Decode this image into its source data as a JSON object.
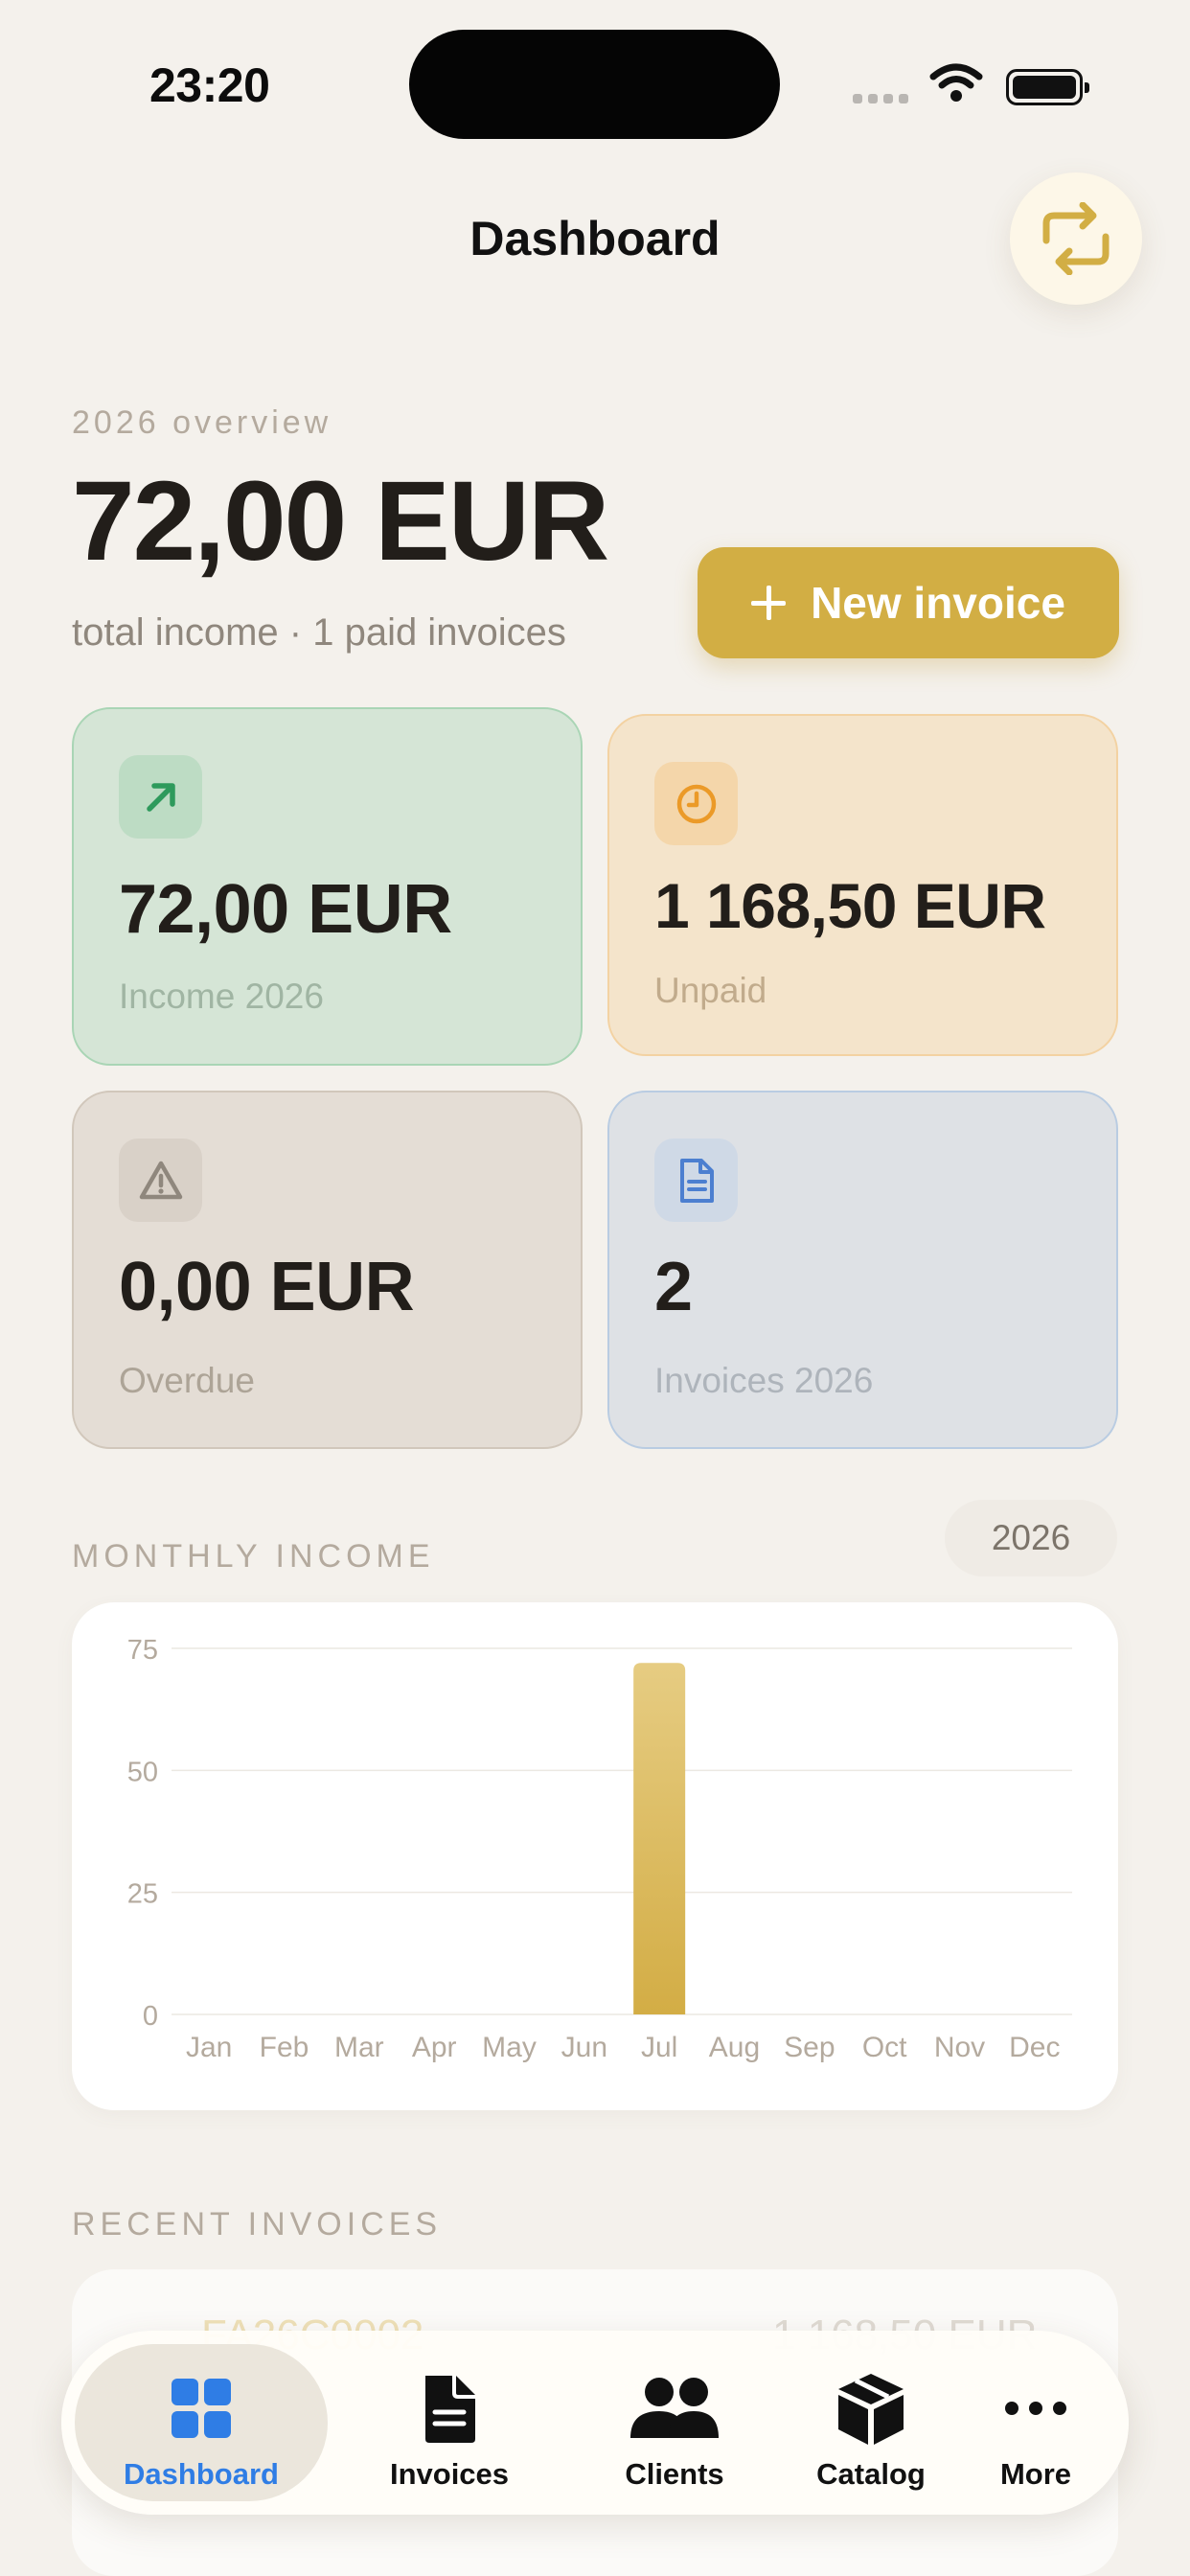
{
  "status_bar": {
    "time": "23:20"
  },
  "header": {
    "title": "Dashboard",
    "sync_icon": "arrows-repeat-icon"
  },
  "overview": {
    "label": "2026 overview",
    "total": "72,00 EUR",
    "subtitle": "total income · 1 paid invoices",
    "new_invoice_label": "New invoice"
  },
  "stats": [
    {
      "value": "72,00 EUR",
      "label": "Income 2026",
      "icon": "arrow-up-right-icon",
      "color": "#2e9a5c"
    },
    {
      "value": "1 168,50 EUR",
      "label": "Unpaid",
      "icon": "clock-icon",
      "color": "#eb9a28"
    },
    {
      "value": "0,00 EUR",
      "label": "Overdue",
      "icon": "warning-triangle-icon",
      "color": "#8f877d"
    },
    {
      "value": "2",
      "label": "Invoices 2026",
      "icon": "document-icon",
      "color": "#4c7fd0"
    }
  ],
  "monthly_income": {
    "label": "MONTHLY INCOME",
    "year": "2026"
  },
  "chart_data": {
    "type": "bar",
    "categories": [
      "Jan",
      "Feb",
      "Mar",
      "Apr",
      "May",
      "Jun",
      "Jul",
      "Aug",
      "Sep",
      "Oct",
      "Nov",
      "Dec"
    ],
    "values": [
      0,
      0,
      0,
      0,
      0,
      0,
      72,
      0,
      0,
      0,
      0,
      0
    ],
    "ylim": [
      0,
      75
    ],
    "yticks": [
      0,
      25,
      50,
      75
    ],
    "grid": true,
    "title": "",
    "xlabel": "",
    "ylabel": "",
    "bar_color_top": "#e6cc82",
    "bar_color_bottom": "#d3ad45"
  },
  "recent_invoices": {
    "label": "RECENT INVOICES",
    "ghost_number": "FA26C0002",
    "ghost_amount": "1 168,50 EUR"
  },
  "tabbar": {
    "items": [
      {
        "label": "Dashboard",
        "icon": "dashboard-grid-icon"
      },
      {
        "label": "Invoices",
        "icon": "document-icon"
      },
      {
        "label": "Clients",
        "icon": "people-icon"
      },
      {
        "label": "Catalog",
        "icon": "box-icon"
      },
      {
        "label": "More",
        "icon": "ellipsis-icon"
      }
    ]
  },
  "colors": {
    "accent": "#d2ae44",
    "active_tab": "#2f7de5",
    "background": "#f4f1ec"
  }
}
